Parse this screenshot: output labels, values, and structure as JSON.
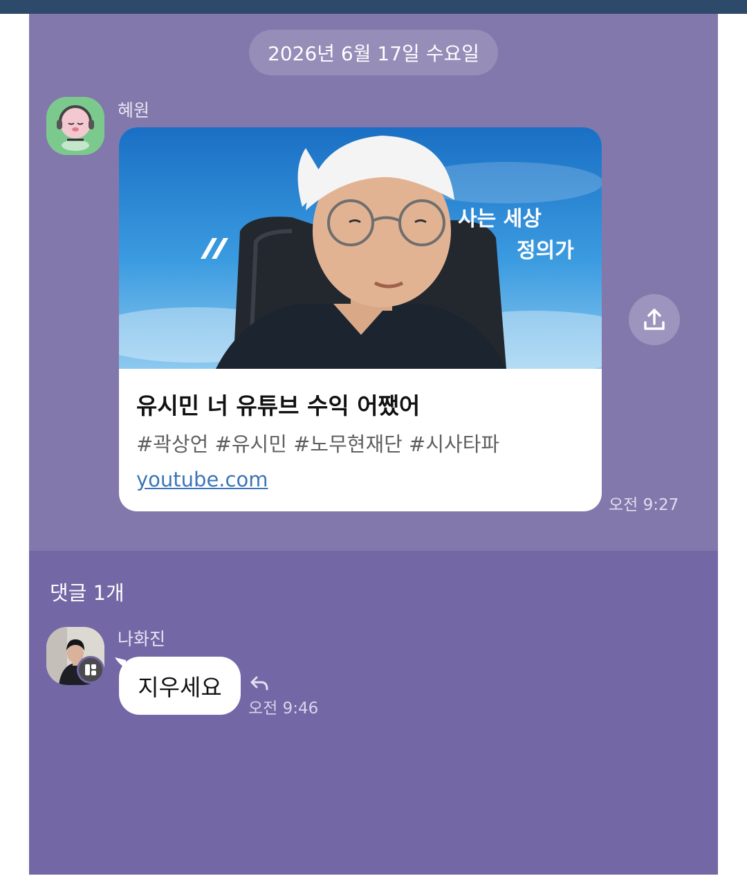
{
  "date_divider": "2026년 6월 17일 수요일",
  "message": {
    "sender": "혜원",
    "avatar_icon": "character-headphones-avatar",
    "link_preview": {
      "title": "유시민 너 유튜브 수익 어쨌어",
      "tags": "#곽상언 #유시민 #노무현재단 #시사타파",
      "domain": "youtube.com",
      "thumbnail_icon": "video-thumbnail",
      "thumbnail_text_line1": "사는 세상",
      "thumbnail_text_line2": "정의가"
    },
    "share_icon": "share-upload-icon",
    "time": "오전 9:27"
  },
  "comments": {
    "count_label": "댓글 1개",
    "items": [
      {
        "sender": "나화진",
        "avatar_icon": "profile-photo-avatar",
        "badge_icon": "app-badge-icon",
        "text": "지우세요",
        "reply_icon": "reply-arrow-icon",
        "time": "오전 9:46"
      }
    ]
  },
  "colors": {
    "chat_background": "#8278ab",
    "comment_background": "#7367a5",
    "top_bar": "#2e4a6b",
    "link": "#3c74b8"
  }
}
